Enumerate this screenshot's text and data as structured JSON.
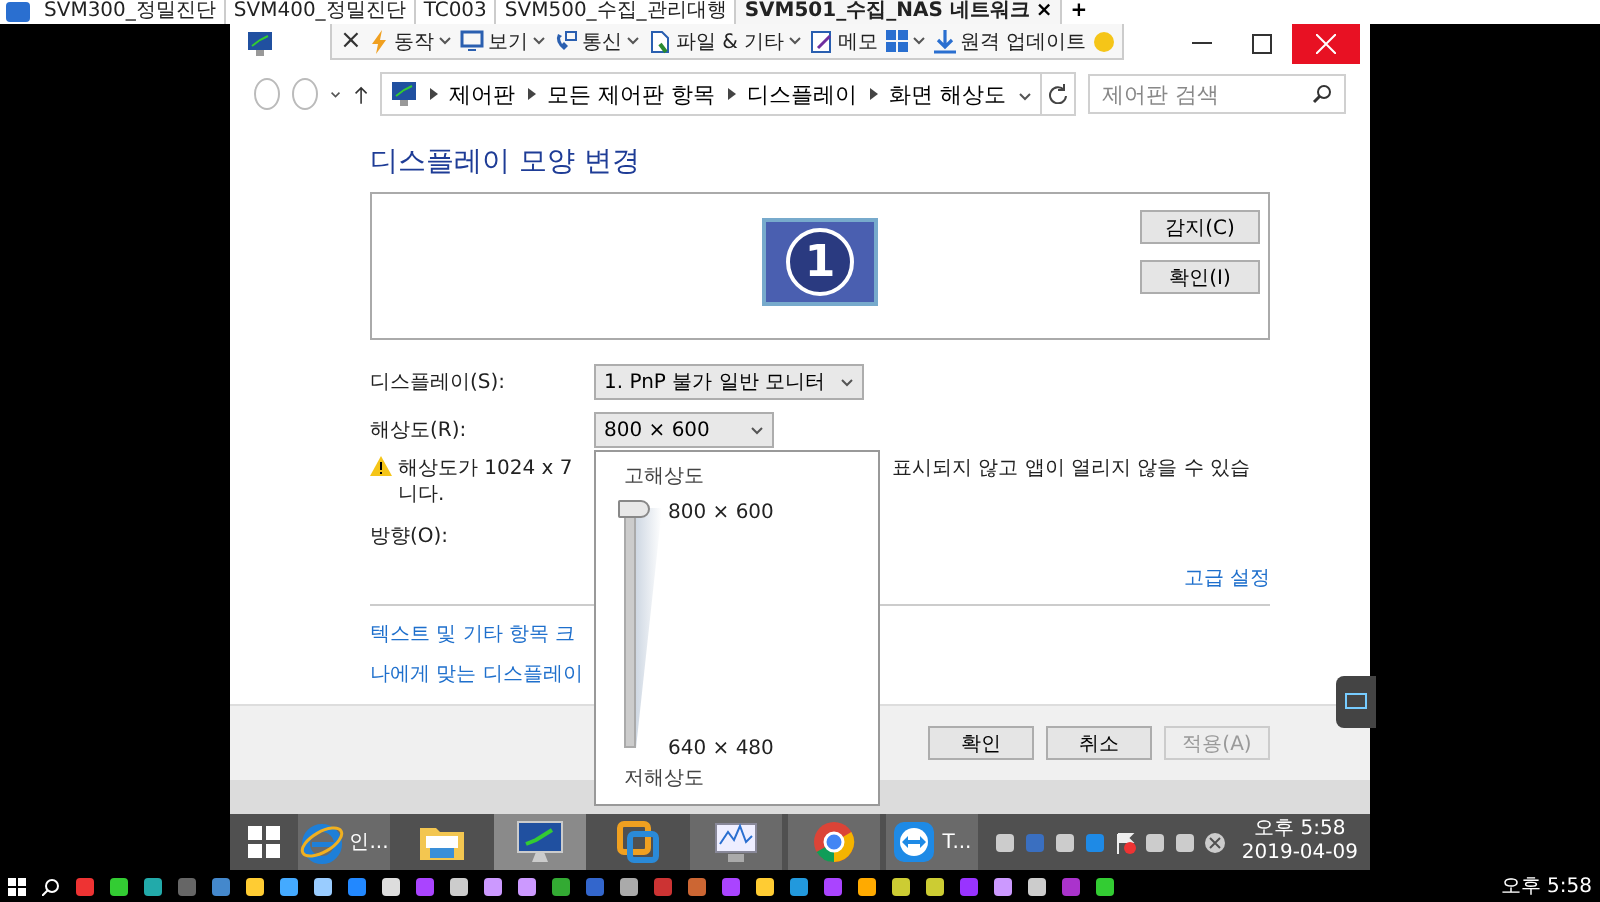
{
  "browser_tabs": [
    {
      "label": "SVM300_정밀진단",
      "selected": false
    },
    {
      "label": "SVM400_정밀진단",
      "selected": false
    },
    {
      "label": "TC003",
      "selected": false
    },
    {
      "label": "SVM500_수집_관리대행",
      "selected": false
    },
    {
      "label": "SVM501_수집_NAS 네트워크",
      "selected": true
    }
  ],
  "tab_close": "×",
  "new_tab": "+",
  "remote_toolbar": {
    "close": "×",
    "items": [
      {
        "label": "동작",
        "dropdown": true
      },
      {
        "label": "보기",
        "dropdown": true
      },
      {
        "label": "통신",
        "dropdown": true
      },
      {
        "label": "파일 & 기타",
        "dropdown": true
      },
      {
        "label": "메모",
        "dropdown": false
      },
      {
        "dropdown": true
      },
      {
        "label": "원격 업데이트",
        "dropdown": false
      }
    ]
  },
  "address_bar": {
    "breadcrumbs": [
      "제어판",
      "모든 제어판 항목",
      "디스플레이",
      "화면 해상도"
    ],
    "search_placeholder": "제어판 검색"
  },
  "heading": "디스플레이 모양 변경",
  "preview": {
    "monitor_number": "1",
    "buttons": [
      "감지(C)",
      "확인(I)"
    ]
  },
  "display_field": {
    "label": "디스플레이(S):",
    "value": "1. PnP 불가 일반 모니터"
  },
  "resolution_field": {
    "label": "해상도(R):",
    "value": "800 × 600"
  },
  "warning": {
    "start": "해상도가 1024 x 7",
    "end": "표시되지 않고 앱이 열리지 않을 수 있습",
    "continuation": "니다."
  },
  "orientation_label": "방향(O):",
  "advanced_link": "고급 설정",
  "links": [
    "텍스트 및 기타 항목 크",
    "나에게 맞는 디스플레이"
  ],
  "buttons": [
    {
      "label": "확인",
      "disabled": false
    },
    {
      "label": "취소",
      "disabled": false
    },
    {
      "label": "적용(A)",
      "disabled": true
    }
  ],
  "resolution_popup": {
    "high_label": "고해상도",
    "max_value": "800 × 600",
    "min_value": "640 × 480",
    "low_label": "저해상도",
    "level": 1
  },
  "remote_taskbar": {
    "apps": [
      {
        "label": "인...",
        "running": true,
        "selected": false
      },
      {
        "running": false,
        "selected": false
      },
      {
        "running": true,
        "selected": true
      },
      {
        "running": false,
        "selected": false
      },
      {
        "running": true,
        "selected": false
      },
      {
        "running": true,
        "selected": false
      },
      {
        "label": "T...",
        "running": true,
        "selected": false
      }
    ],
    "time": "오후 5:58",
    "date": "2019-04-09"
  },
  "host_taskbar": {
    "time": "오후 5:58"
  }
}
